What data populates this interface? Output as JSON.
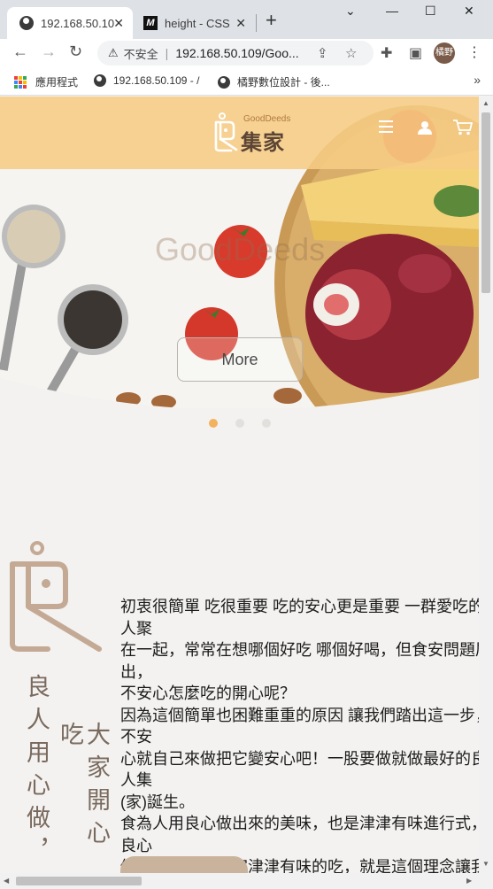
{
  "browser": {
    "tabs": [
      {
        "title": "192.168.50.10",
        "icon": "globe-icon"
      },
      {
        "title": "height - CSS",
        "icon": "mdn-icon"
      }
    ],
    "new_tab": "+",
    "window_controls": {
      "minimize": "—",
      "maximize": "☐",
      "close": "✕",
      "menu": "⌄"
    },
    "address": {
      "warning": "⚠",
      "insecure_label": "不安全",
      "separator": "|",
      "url": "192.168.50.109/Goo..."
    },
    "profile_label": "橘野",
    "bookmarks": [
      {
        "label": "應用程式",
        "icon": "apps-icon"
      },
      {
        "label": "192.168.50.109 - /",
        "icon": "globe-icon"
      },
      {
        "label": "橘野數位設計 - 後...",
        "icon": "globe-icon"
      }
    ],
    "bookmarks_more": "»"
  },
  "site": {
    "logo": {
      "en": "GoodDeeds",
      "cn": "集家"
    },
    "hero": {
      "watermark": "GoodDeeds",
      "cta": "More",
      "slides": 3,
      "active_slide": 1
    },
    "brand_vertical": {
      "col1": "良人用心做，",
      "col2": "大家開心吃"
    },
    "intro": "初衷很簡單 吃很重要 吃的安心更是重要 一群愛吃的人聚\n在一起，常常在想哪個好吃 哪個好喝，但食安問題層出，\n不安心怎麼吃的開心呢？\n因為這個簡單也困難重重的原因 讓我們踏出這一步，不安\n心就自己來做把它變安心吧！一股要做就做最好的良人集\n(家)誕生。\n食為人用良心做出來的美味，也是津津有味進行式，良心\n做出的美味讓大家津津有味的吃，就是這個理念讓我們集在一\n起，便是良人集。"
  },
  "colors": {
    "header_bg": "#f6cc84",
    "accent": "#f2b25e",
    "logo_brown": "#c4a994",
    "text_brown": "#7a6a5e"
  }
}
